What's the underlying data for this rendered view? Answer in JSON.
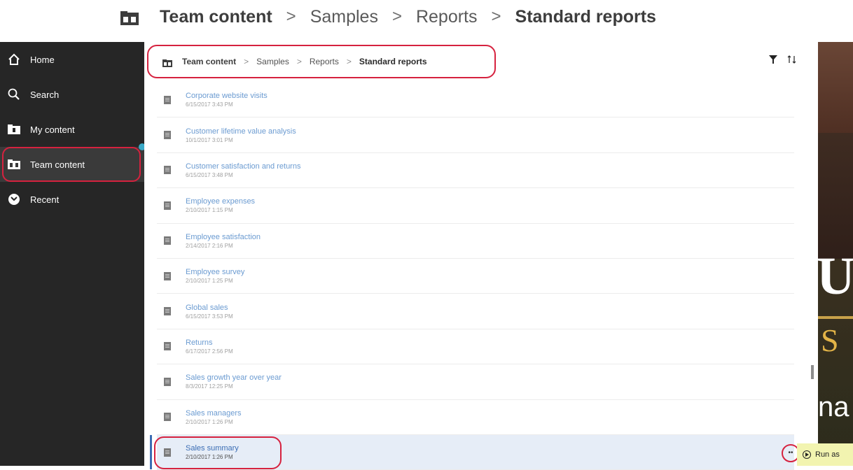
{
  "callout_breadcrumb": [
    "Team content",
    "Samples",
    "Reports",
    "Standard reports"
  ],
  "sidebar": {
    "items": [
      {
        "label": "Home",
        "icon": "home-icon"
      },
      {
        "label": "Search",
        "icon": "search-icon"
      },
      {
        "label": "My content",
        "icon": "my-content-folder-icon"
      },
      {
        "label": "Team content",
        "icon": "team-content-folder-icon"
      },
      {
        "label": "Recent",
        "icon": "recent-clock-icon"
      }
    ],
    "active": "Team content"
  },
  "breadcrumb": [
    "Team content",
    "Samples",
    "Reports",
    "Standard reports"
  ],
  "toolbar": {
    "filter_icon": "filter-icon",
    "sort_icon": "sort-icon"
  },
  "reports": [
    {
      "name": "Corporate website visits",
      "date": "6/15/2017 3:43 PM"
    },
    {
      "name": "Customer lifetime value analysis",
      "date": "10/1/2017 3:01 PM"
    },
    {
      "name": "Customer satisfaction and returns",
      "date": "6/15/2017 3:48 PM"
    },
    {
      "name": "Employee expenses",
      "date": "2/10/2017 1:15 PM"
    },
    {
      "name": "Employee satisfaction",
      "date": "2/14/2017 2:16 PM"
    },
    {
      "name": "Employee survey",
      "date": "2/10/2017 1:25 PM"
    },
    {
      "name": "Global sales",
      "date": "6/15/2017 3:53 PM"
    },
    {
      "name": "Returns",
      "date": "6/17/2017 2:56 PM"
    },
    {
      "name": "Sales growth year over year",
      "date": "8/3/2017 12:25 PM"
    },
    {
      "name": "Sales managers",
      "date": "2/10/2017 1:26 PM"
    },
    {
      "name": "Sales summary",
      "date": "2/10/2017 1:26 PM"
    }
  ],
  "selected_report": "Sales summary",
  "more_button": "••",
  "run_as_label": "Run as",
  "photo_text": {
    "letter_u": "U",
    "letter_s": "S",
    "text_na": "na"
  },
  "colors": {
    "sidebar_bg": "#262626",
    "highlight": "#d6223f",
    "link": "#6b9bd1",
    "selected_bg": "#e6edf7"
  }
}
